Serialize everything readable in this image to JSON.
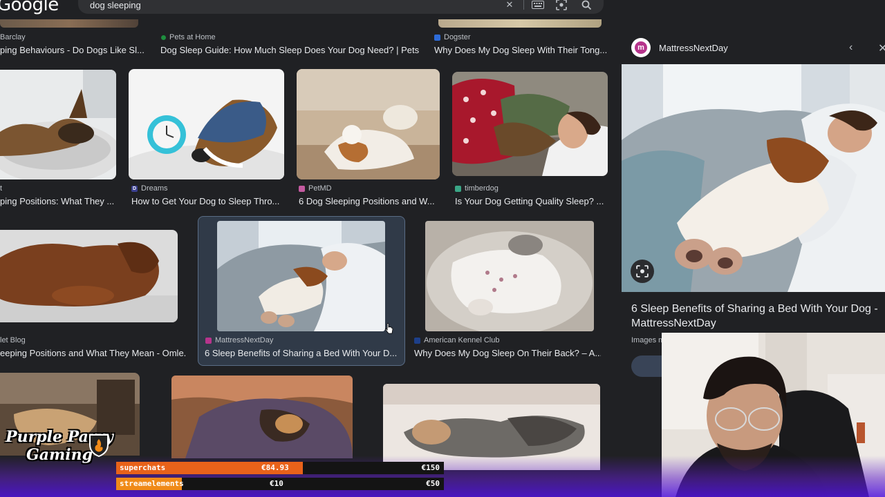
{
  "header": {
    "logo": "Google",
    "query": "dog sleeping",
    "icons": [
      "close-icon",
      "keyboard-icon",
      "lens-icon",
      "search-icon"
    ]
  },
  "results": {
    "row1": [
      {
        "source": "Barclay",
        "title": "ping Behaviours - Do Dogs Like Sl..."
      },
      {
        "source": "Pets at Home",
        "title": "Dog Sleep Guide: How Much Sleep Does Your Dog Need? | Pets"
      },
      {
        "source": "Dogster",
        "title": "Why Does My Dog Sleep With Their Tong..."
      }
    ],
    "row2": [
      {
        "source": "t",
        "title": "ping Positions: What They ..."
      },
      {
        "source": "Dreams",
        "title": "How to Get Your Dog to Sleep Thro..."
      },
      {
        "source": "PetMD",
        "title": "6 Dog Sleeping Positions and W..."
      },
      {
        "source": "timberdog",
        "title": "Is Your Dog Getting Quality Sleep? ..."
      }
    ],
    "row3": [
      {
        "source": "let Blog",
        "title": "eeping Positions and What They Mean - Omle..."
      },
      {
        "source": "MattressNextDay",
        "title": "6 Sleep Benefits of Sharing a Bed With Your D..."
      },
      {
        "source": "American Kennel Club",
        "title": "Why Does My Dog Sleep On Their Back? – A..."
      }
    ]
  },
  "panel": {
    "source": "MattressNextDay",
    "title": "6 Sleep Benefits of Sharing a Bed With Your Dog - MattressNextDay",
    "meta": "Images m"
  },
  "overlay": {
    "logo_text": "Purple Parry Gaming",
    "superchats_label": "superchats",
    "superchats_amount": "€84.93",
    "superchats_goal": "€150",
    "superchats_progress": 0.57,
    "streamelements_label": "streamelements",
    "streamelements_amount": "€10",
    "streamelements_goal": "€50",
    "streamelements_progress": 0.2
  },
  "colors": {
    "background": "#202124",
    "selected_border": "#5a6d86",
    "superchats_bar": "#e8621a",
    "streamelements_bar": "#f08a18"
  }
}
